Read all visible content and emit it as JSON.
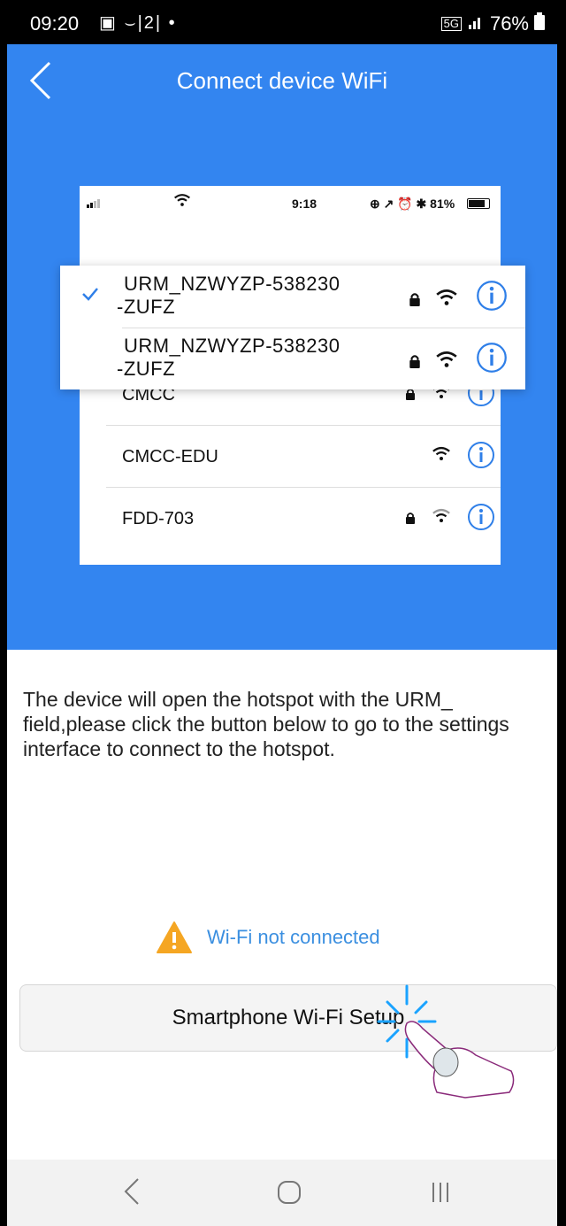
{
  "status_bar": {
    "time": "09:20",
    "left_icons": "▣ ⌣|2| •",
    "network": "5G",
    "battery": "76%"
  },
  "header": {
    "title": "Connect device WiFi",
    "back_icon": "chevron-left-icon"
  },
  "illustration": {
    "mini_status": {
      "time": "9:18",
      "right": "⊕ ↗ ⏰ ✱ 81%"
    },
    "highlighted": [
      {
        "name_line1": "URM_NZWYZP-538230",
        "name_line2": "-ZUFZ",
        "selected": true
      },
      {
        "name_line1": "URM_NZWYZP-538230",
        "name_line2": "-ZUFZ",
        "selected": false
      }
    ],
    "networks": [
      {
        "name": "CMCC",
        "locked": true
      },
      {
        "name": "CMCC-EDU",
        "locked": false
      },
      {
        "name": "FDD-703",
        "locked": true
      }
    ]
  },
  "description": "The device will open the hotspot with the URM_ field,please click the button below to go to the settings interface to connect to the hotspot.",
  "warning": {
    "text": "Wi-Fi not connected",
    "icon": "warning-triangle-icon",
    "color": "#f5a623"
  },
  "setup_button": {
    "label": "Smartphone Wi-Fi Setup"
  },
  "colors": {
    "accent": "#3385f0",
    "link": "#3b8fe0"
  }
}
